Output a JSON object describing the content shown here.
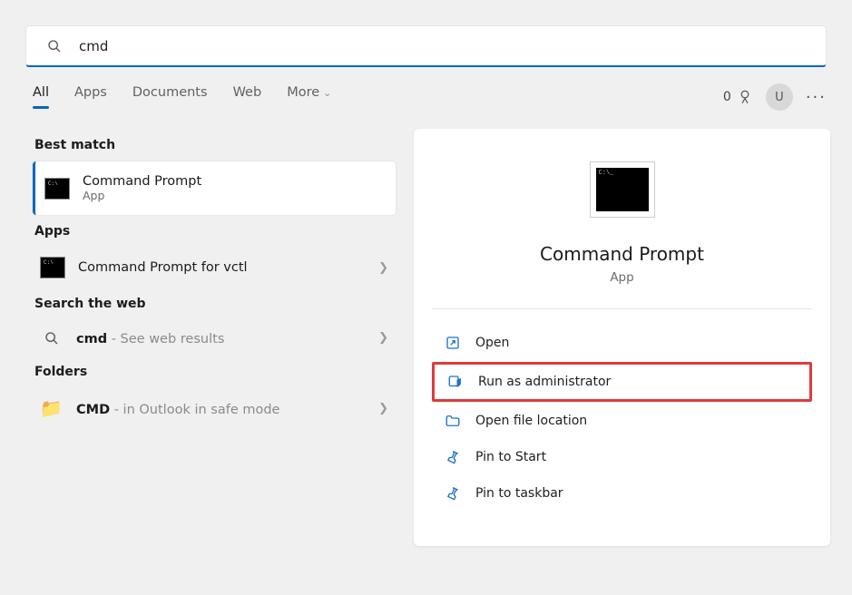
{
  "search": {
    "query": "cmd"
  },
  "tabs": [
    "All",
    "Apps",
    "Documents",
    "Web",
    "More"
  ],
  "active_tab": "All",
  "rewards": {
    "count": "0",
    "avatar_initial": "U"
  },
  "left": {
    "best_match_label": "Best match",
    "best_match": {
      "title": "Command Prompt",
      "subtitle": "App"
    },
    "apps_label": "Apps",
    "apps": [
      {
        "title": "Command Prompt for vctl"
      }
    ],
    "search_web_label": "Search the web",
    "search_web": {
      "q": "cmd",
      "suffix": " - See web results"
    },
    "folders_label": "Folders",
    "folders": [
      {
        "title": "CMD",
        "suffix": " - in Outlook in safe mode"
      }
    ]
  },
  "right": {
    "title": "Command Prompt",
    "subtitle": "App",
    "actions": [
      {
        "key": "open",
        "label": "Open",
        "icon": "open"
      },
      {
        "key": "run_admin",
        "label": "Run as administrator",
        "icon": "shield",
        "highlighted": true
      },
      {
        "key": "open_location",
        "label": "Open file location",
        "icon": "folder"
      },
      {
        "key": "pin_start",
        "label": "Pin to Start",
        "icon": "pin"
      },
      {
        "key": "pin_taskbar",
        "label": "Pin to taskbar",
        "icon": "pin"
      }
    ]
  }
}
